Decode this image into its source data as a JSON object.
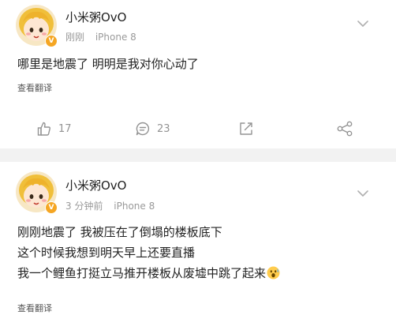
{
  "posts": [
    {
      "username": "小米粥OvO",
      "time": "刚刚",
      "device": "iPhone 8",
      "lines": [
        "哪里是地震了 明明是我对你心动了"
      ],
      "translate_label": "查看翻译",
      "likes": "17",
      "comments": "23"
    },
    {
      "username": "小米粥OvO",
      "time": "3 分钟前",
      "device": "iPhone 8",
      "lines": [
        "刚刚地震了 我被压在了倒塌的楼板底下",
        "这个时候我想到明天早上还要直播",
        "我一个鲤鱼打挺立马推开楼板从废墟中跳了起来"
      ],
      "translate_label": "查看翻译"
    }
  ],
  "icons": {
    "like": "thumbs-up-icon",
    "comment": "comment-icon",
    "share": "share-out-icon",
    "forward": "forward-share-icon",
    "verified": "verified-v-badge",
    "more": "chevron-down-icon",
    "emoji": "shocked-face-emoji"
  },
  "colors": {
    "background": "#f2f2f2",
    "card": "#ffffff",
    "text": "#222222",
    "meta": "#9a9a9a",
    "icon": "#939393",
    "badge": "#f5a623"
  }
}
